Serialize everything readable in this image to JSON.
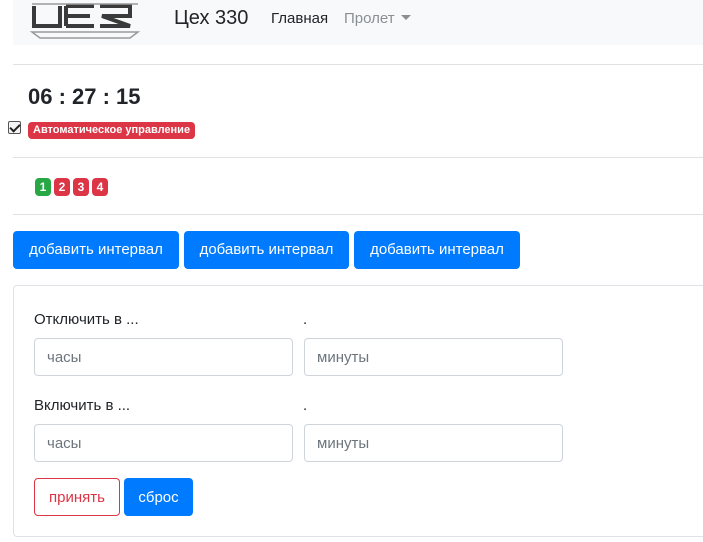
{
  "navbar": {
    "logo_icon": "stylized-metal-logo",
    "brand": "Цех 330",
    "home_link": "Главная",
    "dropdown_link": "Пролет"
  },
  "clock": {
    "time": "06 : 27 : 15"
  },
  "mode": {
    "checkbox_checked": true,
    "auto_label": "Автоматическое управление"
  },
  "sections": [
    {
      "label": "1",
      "color": "#28a745"
    },
    {
      "label": "2",
      "color": "#dc3545"
    },
    {
      "label": "3",
      "color": "#dc3545"
    },
    {
      "label": "4",
      "color": "#dc3545"
    }
  ],
  "add_buttons": [
    "добавить интервал",
    "добавить интервал",
    "добавить интервал"
  ],
  "interval_form": {
    "off_label": "Отключить в ...",
    "off_separator": ".",
    "on_label": "Включить в ...",
    "on_separator": ".",
    "hours_placeholder": "часы",
    "minutes_placeholder": "минуты",
    "accept_label": "принять",
    "reset_label": "сброс"
  },
  "colors": {
    "primary": "#007bff",
    "danger": "#dc3545",
    "success": "#28a745"
  }
}
